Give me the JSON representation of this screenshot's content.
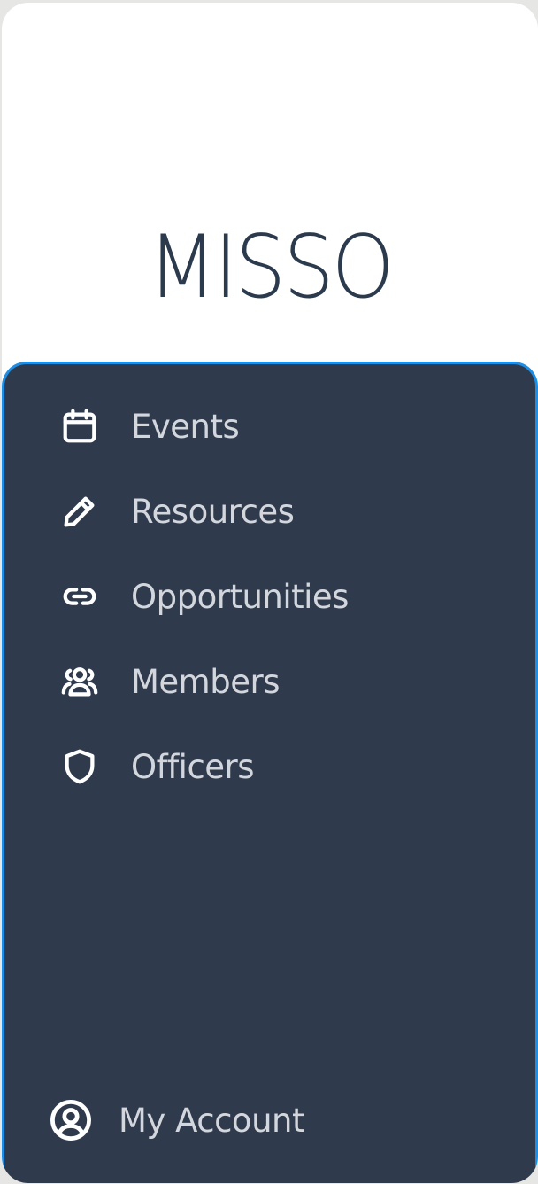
{
  "brand": {
    "title": "MISSO"
  },
  "nav": {
    "items": [
      {
        "label": "Events",
        "icon": "calendar-icon"
      },
      {
        "label": "Resources",
        "icon": "pencil-icon"
      },
      {
        "label": "Opportunities",
        "icon": "link-icon"
      },
      {
        "label": "Members",
        "icon": "users-icon"
      },
      {
        "label": "Officers",
        "icon": "shield-icon"
      }
    ],
    "account": {
      "label": "My Account",
      "icon": "user-circle-icon"
    }
  },
  "colors": {
    "panel": "#2f3b4d",
    "accent_border": "#1e8fe6",
    "label": "#d3d6dc",
    "brand": "#2b3a4c"
  }
}
